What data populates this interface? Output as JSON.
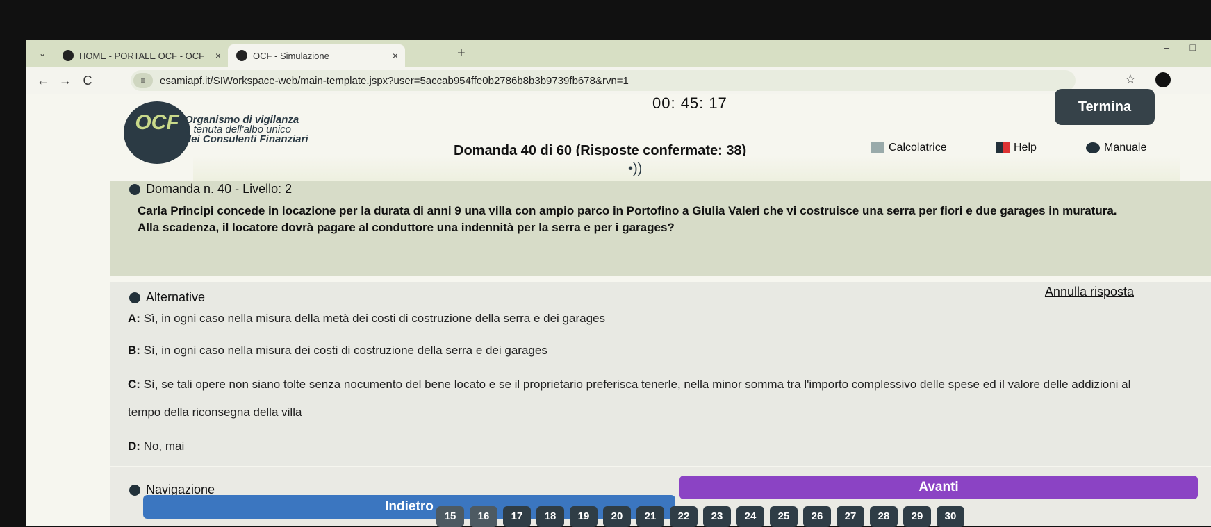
{
  "browser": {
    "tabs": [
      {
        "title": "HOME - PORTALE OCF - OCF",
        "close": "×"
      },
      {
        "title": "OCF - Simulazione",
        "close": "×"
      }
    ],
    "new_tab": "+",
    "dropdown": "⌄",
    "url": "esamiapf.it/SIWorkspace-web/main-template.jspx?user=5accab954ffe0b2786b8b3b9739fb678&rvn=1",
    "nav": {
      "back": "←",
      "forward": "→",
      "reload": "C"
    },
    "tune_icon": "≡",
    "star": "☆",
    "minimize": "–",
    "maximize": "□"
  },
  "header": {
    "logo": "OCF",
    "org_line1": "Organismo di vigilanza",
    "org_line2": "e tenuta dell'albo unico",
    "org_line3": "dei Consulenti Finanziari",
    "timer": "00: 45: 17",
    "termina_label": "Termina",
    "question_counter": "Domanda 40 di 60 (Risposte confermate: 38)",
    "calcolatrice": "Calcolatrice",
    "help": "Help",
    "manuale": "Manuale",
    "sound_icon": "•))"
  },
  "question": {
    "title": "Domanda n. 40 - Livello: 2",
    "text": "Carla Principi concede in locazione per la durata di anni 9 una villa con ampio parco in Portofino a Giulia Valeri che vi costruisce una serra per fiori e due garages in muratura. Alla scadenza, il locatore dovrà pagare al conduttore una indennità per la serra e per i garages?"
  },
  "alternatives": {
    "title": "Alternative",
    "annulla_label": "Annulla risposta",
    "options": [
      {
        "letter": "A:",
        "text": "Sì, in ogni caso nella misura della metà dei costi di costruzione della serra e dei garages"
      },
      {
        "letter": "B:",
        "text": "Sì, in ogni caso nella misura dei costi di costruzione della serra e dei garages"
      },
      {
        "letter": "C:",
        "text": "Sì, se tali opere non siano tolte senza nocumento del bene locato e se il proprietario preferisca tenerle, nella minor somma tra l'importo complessivo delle spese ed il valore delle addizioni al tempo della riconsegna della villa"
      },
      {
        "letter": "D:",
        "text": "No, mai"
      }
    ]
  },
  "navigation": {
    "title": "Navigazione",
    "prev_label": "Indietro",
    "next_label": "Avanti",
    "pages": [
      "15",
      "16",
      "17",
      "18",
      "19",
      "20",
      "21",
      "22",
      "23",
      "24",
      "25",
      "26",
      "27",
      "28",
      "29",
      "30"
    ]
  },
  "colors": {
    "accent_dark": "#364249",
    "prev_button": "#3b76c0",
    "next_button": "#8b43c4",
    "logo_green": "#c9d98a"
  }
}
